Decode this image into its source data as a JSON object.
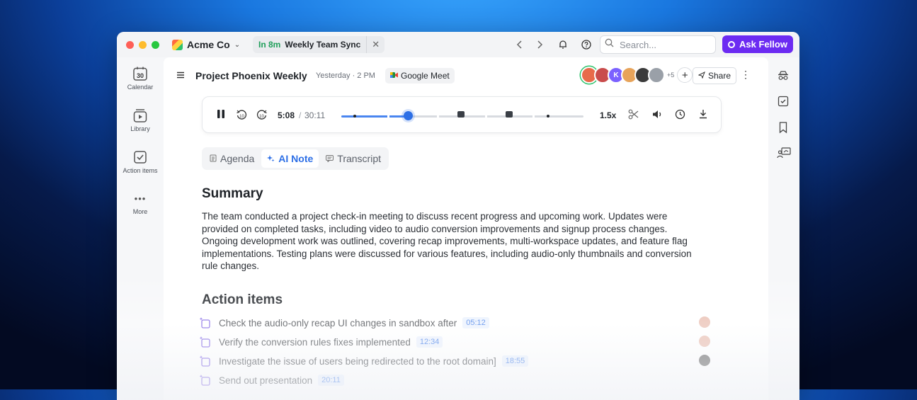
{
  "titlebar": {
    "workspace_name": "Acme Co",
    "tab": {
      "soon": "In 8m",
      "name": "Weekly Team Sync",
      "close": "✕"
    },
    "search_placeholder": "Search...",
    "ask_button": "Ask Fellow"
  },
  "leftnav": {
    "items": [
      {
        "label": "Calendar",
        "icon": "calendar-icon",
        "day": "30"
      },
      {
        "label": "Library",
        "icon": "library-icon"
      },
      {
        "label": "Action items",
        "icon": "checkbox-icon"
      },
      {
        "label": "More",
        "icon": "more-icon",
        "glyph": "•••"
      }
    ]
  },
  "header": {
    "title": "Project Phoenix Weekly",
    "when": "Yesterday · 2 PM",
    "meeting_app": "Google Meet",
    "avatars": [
      {
        "initial": "",
        "color": "#e86a4a"
      },
      {
        "initial": "",
        "color": "#c94c4c"
      },
      {
        "initial": "K",
        "color": "#7b61ff"
      },
      {
        "initial": "",
        "color": "#e7a35a"
      },
      {
        "initial": "",
        "color": "#3b3b3b"
      },
      {
        "initial": "",
        "color": "#9aa0a8"
      }
    ],
    "more_count": "+5",
    "add": "+",
    "share_label": "Share"
  },
  "player": {
    "current_time": "5:08",
    "separator": "/",
    "total_time": "30:11",
    "progress": 0.275,
    "speed": "1.5x"
  },
  "note_tabs": [
    {
      "label": "Agenda",
      "active": false
    },
    {
      "label": "AI Note",
      "active": true
    },
    {
      "label": "Transcript",
      "active": false
    }
  ],
  "summary": {
    "heading": "Summary",
    "text": "The team conducted a project check-in meeting to discuss recent progress and upcoming work. Updates were provided on completed tasks, including video to audio conversion improvements and signup process changes. Ongoing development work was outlined, covering recap improvements, multi-workspace updates, and feature flag implementations. Testing plans were discussed for various features, including audio-only thumbnails and conversion rule changes."
  },
  "action_items": {
    "heading": "Action items",
    "items": [
      {
        "text": "Check the audio-only recap UI changes in sandbox after",
        "timestamp": "05:12"
      },
      {
        "text": "Verify the conversion rules fixes implemented",
        "timestamp": "12:34"
      },
      {
        "text": "Investigate the issue of users being redirected to the root domain]",
        "timestamp": "18:55"
      },
      {
        "text": "Send out presentation",
        "timestamp": "20:11"
      }
    ]
  },
  "colors": {
    "accent": "#2d6fe6",
    "ask_button": "#6c2bf2",
    "soon": "#1e9e59"
  }
}
